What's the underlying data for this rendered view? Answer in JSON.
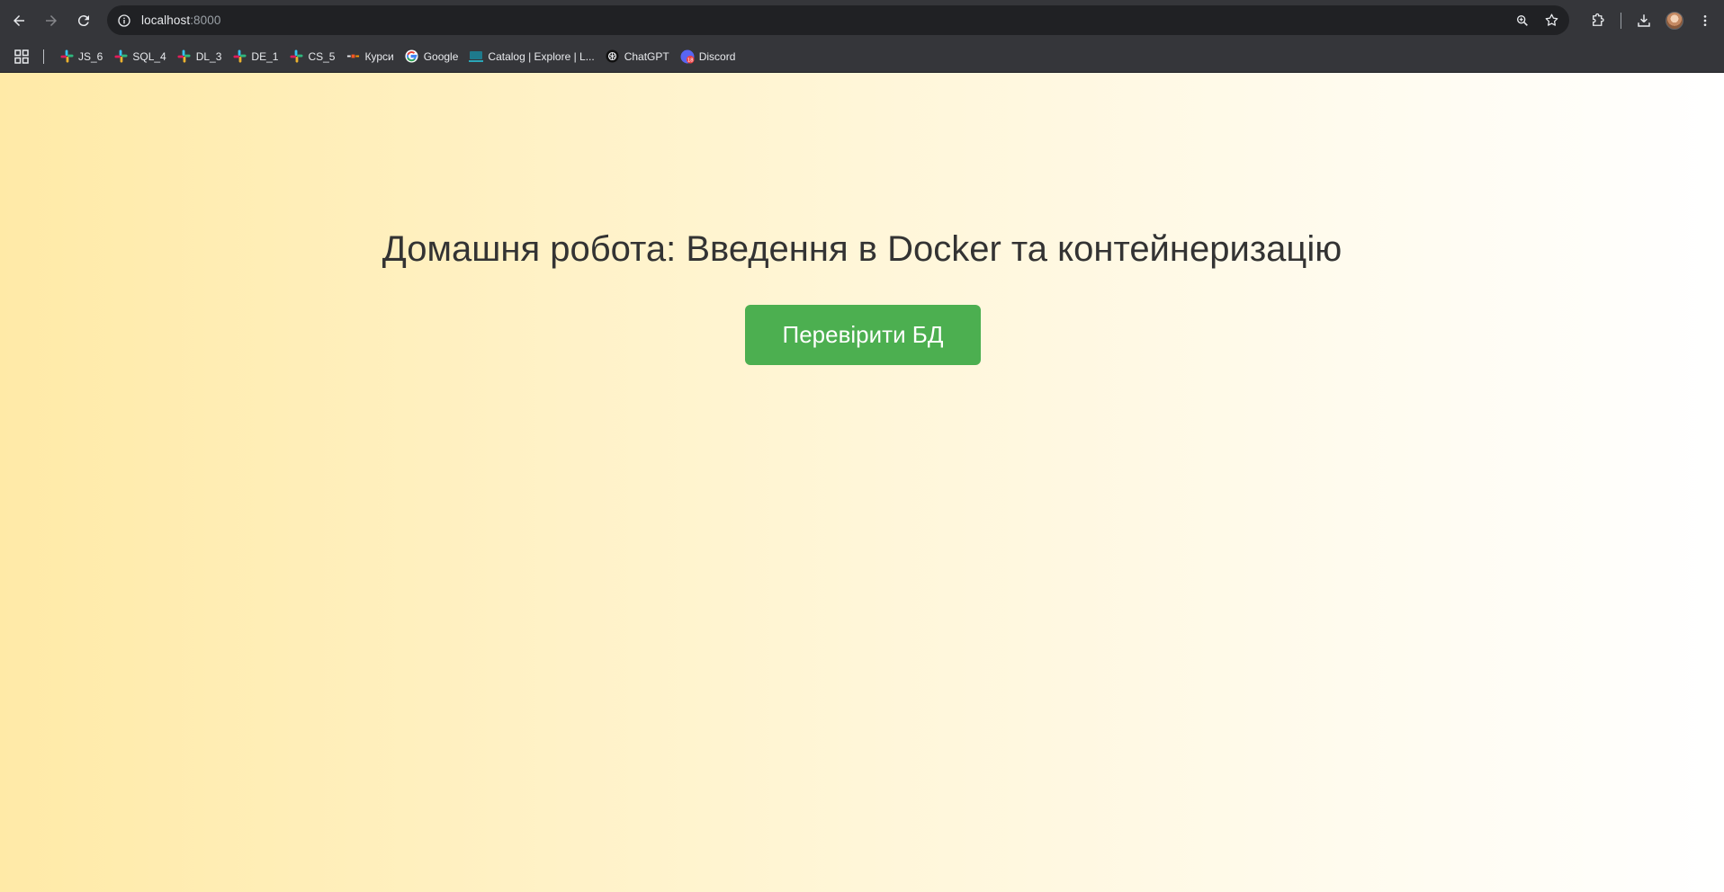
{
  "browser": {
    "url_host": "localhost",
    "url_port": ":8000"
  },
  "bookmarks": [
    {
      "label": "JS_6",
      "icon": "slack-icon"
    },
    {
      "label": "SQL_4",
      "icon": "slack-icon"
    },
    {
      "label": "DL_3",
      "icon": "slack-icon"
    },
    {
      "label": "DE_1",
      "icon": "slack-icon"
    },
    {
      "label": "CS_5",
      "icon": "slack-icon"
    },
    {
      "label": "Курси",
      "icon": "courses-icon"
    },
    {
      "label": "Google",
      "icon": "google-icon"
    },
    {
      "label": "Catalog | Explore | L...",
      "icon": "catalog-icon"
    },
    {
      "label": "ChatGPT",
      "icon": "chatgpt-icon"
    },
    {
      "label": "Discord",
      "icon": "discord-icon"
    }
  ],
  "page": {
    "title": "Домашня робота: Введення в Docker та контейнеризацію",
    "button_label": "Перевірити БД"
  },
  "colors": {
    "button": "#4caf50",
    "gradient_start": "#ffeaa7",
    "gradient_end": "#ffffff"
  }
}
